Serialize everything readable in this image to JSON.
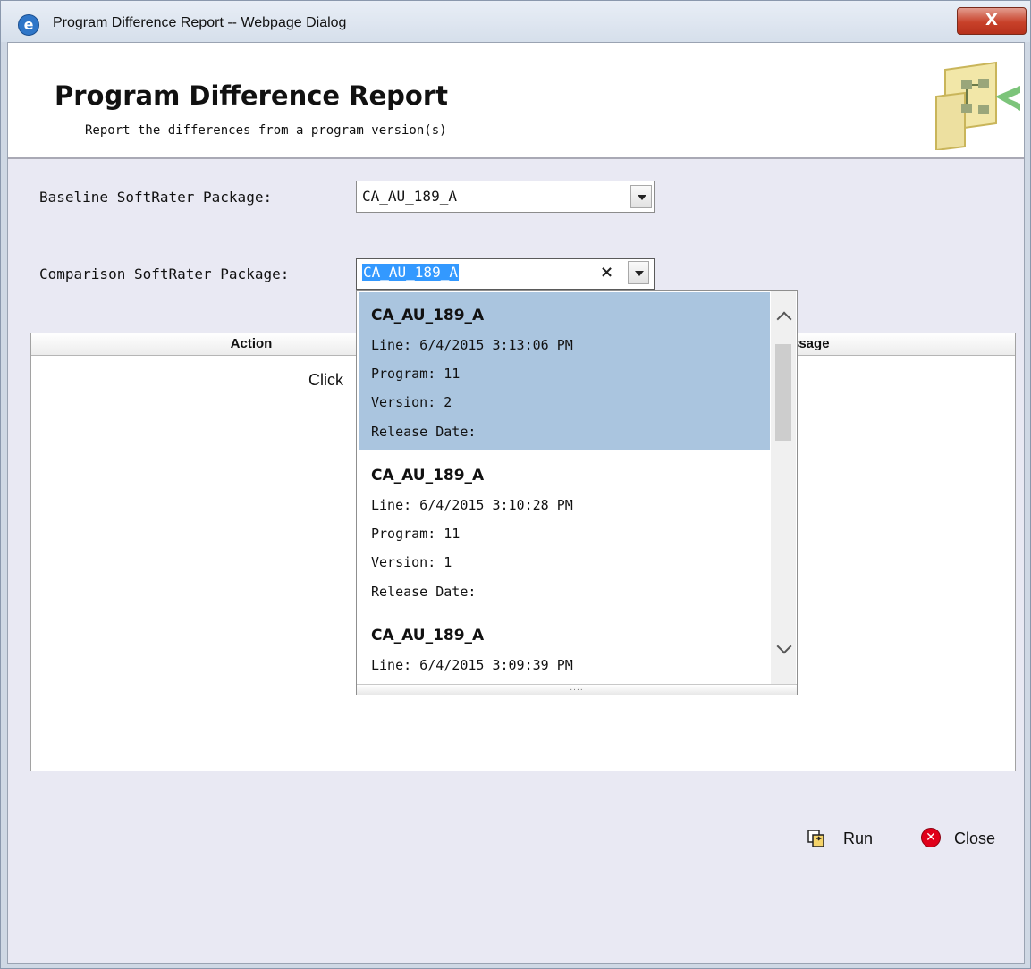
{
  "window": {
    "title": "Program Difference Report -- Webpage Dialog",
    "close_glyph": "X"
  },
  "header": {
    "title": "Program Difference Report",
    "subtitle": "Report the differences from a program version(s)"
  },
  "form": {
    "baseline_label": "Baseline SoftRater Package:",
    "baseline_value": "CA_AU_189_A",
    "comparison_label": "Comparison SoftRater Package:",
    "comparison_value": "CA_AU_189_A",
    "clear_glyph": "×"
  },
  "grid": {
    "columns": [
      "Action",
      "ssage"
    ],
    "message": "Click"
  },
  "dropdown": {
    "items": [
      {
        "name": "CA_AU_189_A",
        "line": "Line: 6/4/2015 3:13:06 PM",
        "program": "Program: 11",
        "version": "Version: 2",
        "release": "Release Date:"
      },
      {
        "name": "CA_AU_189_A",
        "line": "Line: 6/4/2015 3:10:28 PM",
        "program": "Program: 11",
        "version": "Version: 1",
        "release": "Release Date:"
      },
      {
        "name": "CA_AU_189_A",
        "line": "Line: 6/4/2015 3:09:39 PM"
      }
    ],
    "resize_grip": "....",
    "icons": {
      "scroll_up": "chevron-up-icon",
      "scroll_down": "chevron-down-icon"
    }
  },
  "buttons": {
    "run": "Run",
    "close": "Close"
  },
  "icons": {
    "app": "ie-icon",
    "run": "run-icon",
    "close": "close-circle-icon",
    "logo": "flowchart-logo"
  }
}
